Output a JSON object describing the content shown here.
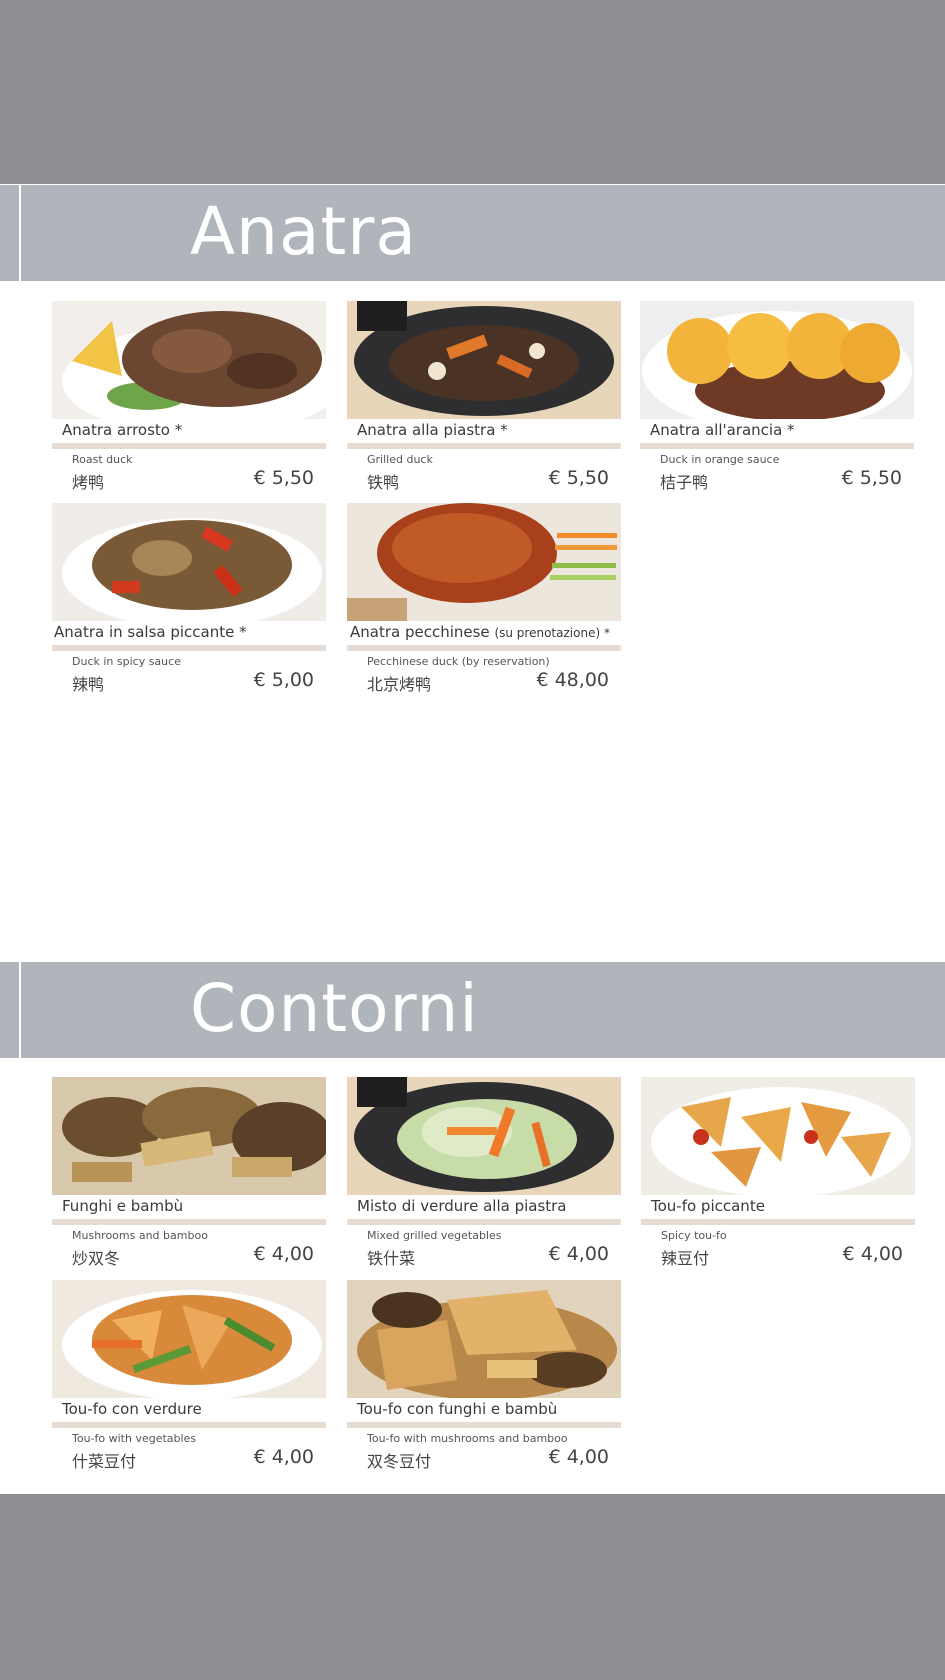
{
  "sections": [
    {
      "title": "Anatra",
      "items": [
        {
          "name": "Anatra arrosto *",
          "note": "",
          "english": "Roast duck",
          "chinese": "烤鸭",
          "price": "€ 5,50"
        },
        {
          "name": "Anatra alla piastra *",
          "note": "",
          "english": "Grilled duck",
          "chinese": "铁鸭",
          "price": "€ 5,50"
        },
        {
          "name": "Anatra all'arancia *",
          "note": "",
          "english": "Duck in orange sauce",
          "chinese": "桔子鸭",
          "price": "€ 5,50"
        },
        {
          "name": "Anatra in salsa piccante *",
          "note": "",
          "english": "Duck in spicy sauce",
          "chinese": "辣鸭",
          "price": "€ 5,00"
        },
        {
          "name": "Anatra pecchinese",
          "note": "(su prenotazione) *",
          "english": "Pecchinese duck (by reservation)",
          "chinese": "北京烤鸭",
          "price": "€ 48,00"
        }
      ]
    },
    {
      "title": "Contorni",
      "items": [
        {
          "name": "Funghi e bambù",
          "note": "",
          "english": "Mushrooms and bamboo",
          "chinese": "炒双冬",
          "price": "€ 4,00"
        },
        {
          "name": "Misto di verdure alla piastra",
          "note": "",
          "english": "Mixed grilled vegetables",
          "chinese": "铁什菜",
          "price": "€ 4,00"
        },
        {
          "name": "Tou-fo piccante",
          "note": "",
          "english": "Spicy tou-fo",
          "chinese": "辣豆付",
          "price": "€ 4,00"
        },
        {
          "name": "Tou-fo con verdure",
          "note": "",
          "english": "Tou-fo with vegetables",
          "chinese": "什菜豆付",
          "price": "€ 4,00"
        },
        {
          "name": "Tou-fo con funghi e bambù",
          "note": "",
          "english": "Tou-fo with mushrooms and bamboo",
          "chinese": "双冬豆付",
          "price": "€ 4,00"
        }
      ]
    }
  ],
  "colors": {
    "background": "#8e8e92",
    "band": "#b0b4bb",
    "text": "#3a3a3a"
  }
}
